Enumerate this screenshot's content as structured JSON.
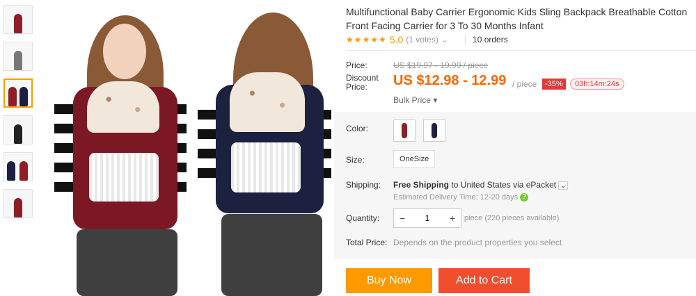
{
  "product": {
    "title": "Multifunctional Baby Carrier Ergonomic Kids Sling Backpack Breathable Cotton Front Facing Carrier for 3 To 30 Months Infant",
    "rating_stars": "★★★★★",
    "rating_value": "5.0",
    "votes": "(1 votes)",
    "orders": "10 orders"
  },
  "pricing": {
    "price_label": "Price:",
    "old_price": "US $19.97 - 19.99 / piece",
    "discount_label": "Discount Price:",
    "new_price": "US $12.98 - 12.99",
    "unit": "/ piece",
    "discount_badge": "-35%",
    "timer": "03h:14m:24s",
    "bulk_price": "Bulk Price ▾"
  },
  "options": {
    "color_label": "Color:",
    "size_label": "Size:",
    "size_value": "OneSize"
  },
  "shipping": {
    "label": "Shipping:",
    "text_bold": "Free Shipping",
    "text_rest": "to United States via ePacket",
    "delivery": "Estimated Delivery Time: 12-20 days"
  },
  "quantity": {
    "label": "Quantity:",
    "minus": "−",
    "value": "1",
    "plus": "+",
    "note": "piece (220 pieces available)"
  },
  "total": {
    "label": "Total Price:",
    "note": "Depends on the product properties you select"
  },
  "actions": {
    "buy_now": "Buy Now",
    "add_to_cart": "Add to Cart"
  },
  "colors": {
    "accent_orange": "#ff9900",
    "cart_red": "#f24d2d",
    "price_orange": "#ff6600"
  }
}
